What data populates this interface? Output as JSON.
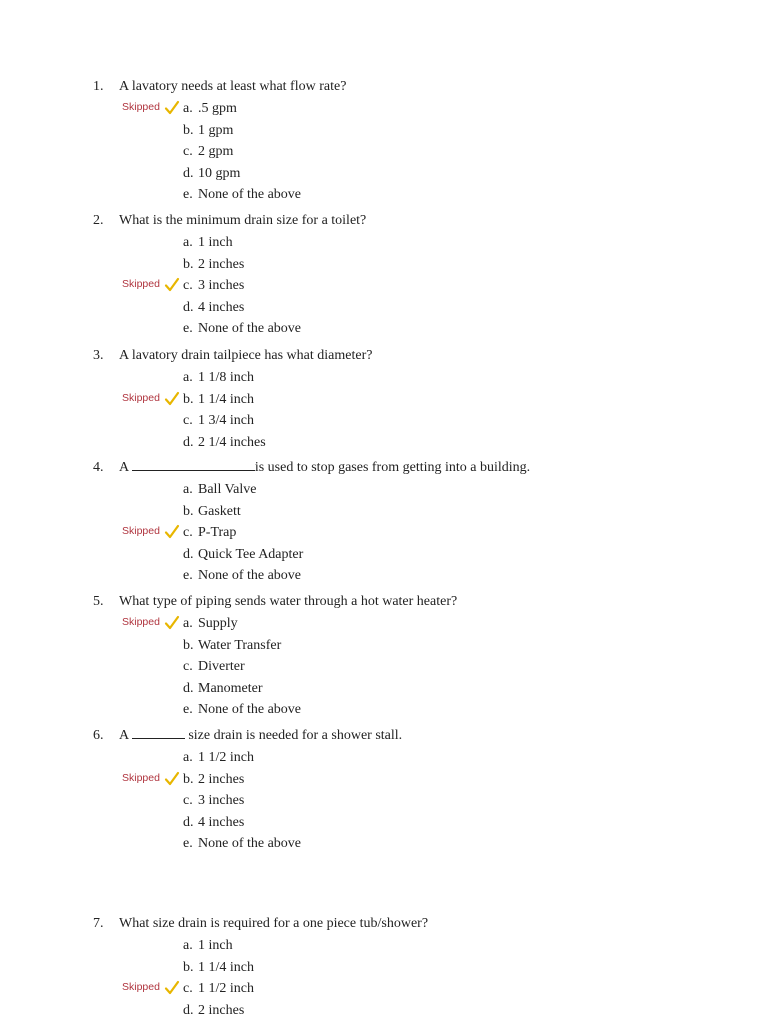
{
  "document": {
    "skipped_label": "Skipped",
    "skipped_color": "#b0353f",
    "check_color": "#e8b600",
    "questions": [
      {
        "number": "1.",
        "text": "A lavatory needs at least what flow rate?",
        "options": [
          {
            "letter": "a.",
            "text": ".5 gpm",
            "skipped": true
          },
          {
            "letter": "b.",
            "text": "1 gpm",
            "skipped": false
          },
          {
            "letter": "c.",
            "text": "2 gpm",
            "skipped": false
          },
          {
            "letter": "d.",
            "text": "10 gpm",
            "skipped": false
          },
          {
            "letter": "e.",
            "text": "None of the above",
            "skipped": false
          }
        ]
      },
      {
        "number": "2.",
        "text": "What is the minimum drain size for a toilet?",
        "options": [
          {
            "letter": "a.",
            "text": "1 inch",
            "skipped": false
          },
          {
            "letter": "b.",
            "text": "2 inches",
            "skipped": false
          },
          {
            "letter": "c.",
            "text": "3 inches",
            "skipped": true
          },
          {
            "letter": "d.",
            "text": "4 inches",
            "skipped": false
          },
          {
            "letter": "e.",
            "text": "None of the above",
            "skipped": false
          }
        ]
      },
      {
        "number": "3.",
        "text": "A lavatory drain tailpiece has what diameter?",
        "options": [
          {
            "letter": "a.",
            "text": "1 1/8 inch",
            "skipped": false
          },
          {
            "letter": "b.",
            "text": "1 1/4 inch",
            "skipped": true
          },
          {
            "letter": "c.",
            "text": "1 3/4 inch",
            "skipped": false
          },
          {
            "letter": "d.",
            "text": "2 1/4 inches",
            "skipped": false
          }
        ]
      },
      {
        "number": "4.",
        "text_before": "A ",
        "text_after": "is used to stop gases from getting into a building.",
        "options": [
          {
            "letter": "a.",
            "text": "Ball Valve",
            "skipped": false
          },
          {
            "letter": "b.",
            "text": "Gaskett",
            "skipped": false
          },
          {
            "letter": "c.",
            "text": "P-Trap",
            "skipped": true
          },
          {
            "letter": "d.",
            "text": "Quick Tee Adapter",
            "skipped": false
          },
          {
            "letter": "e.",
            "text": "None of the above",
            "skipped": false
          }
        ]
      },
      {
        "number": "5.",
        "text": "What type of piping sends water through a hot water heater?",
        "options": [
          {
            "letter": "a.",
            "text": "Supply",
            "skipped": true
          },
          {
            "letter": "b.",
            "text": "Water Transfer",
            "skipped": false
          },
          {
            "letter": "c.",
            "text": "Diverter",
            "skipped": false
          },
          {
            "letter": "d.",
            "text": "Manometer",
            "skipped": false
          },
          {
            "letter": "e.",
            "text": "None of the above",
            "skipped": false
          }
        ]
      },
      {
        "number": "6.",
        "text_before": "A ",
        "text_after": " size drain is needed for a shower stall.",
        "options": [
          {
            "letter": "a.",
            "text": "1 1/2 inch",
            "skipped": false
          },
          {
            "letter": "b.",
            "text": "2 inches",
            "skipped": true
          },
          {
            "letter": "c.",
            "text": "3 inches",
            "skipped": false
          },
          {
            "letter": "d.",
            "text": "4 inches",
            "skipped": false
          },
          {
            "letter": "e.",
            "text": "None of the above",
            "skipped": false
          }
        ]
      },
      {
        "number": "7.",
        "text": "What size drain is required for a one piece tub/shower?",
        "options": [
          {
            "letter": "a.",
            "text": "1 inch",
            "skipped": false
          },
          {
            "letter": "b.",
            "text": "1 1/4 inch",
            "skipped": false
          },
          {
            "letter": "c.",
            "text": "1 1/2 inch",
            "skipped": true
          },
          {
            "letter": "d.",
            "text": "2 inches",
            "skipped": false
          }
        ]
      }
    ]
  }
}
